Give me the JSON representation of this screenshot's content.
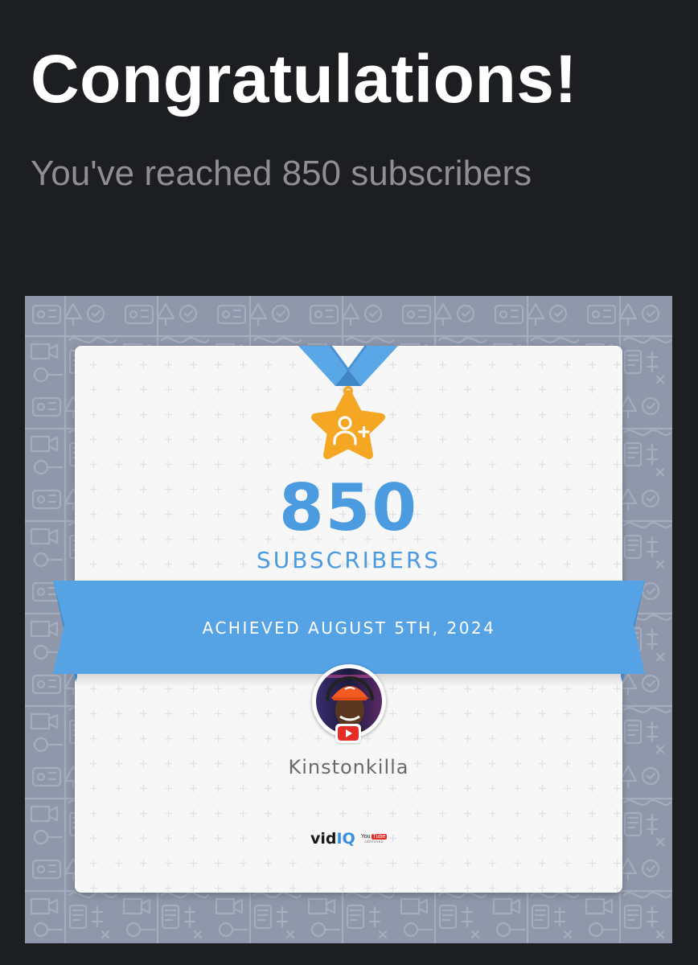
{
  "header": {
    "title": "Congratulations!",
    "subtitle": "You've reached 850 subscribers"
  },
  "card": {
    "count": "850",
    "count_label": "SUBSCRIBERS",
    "ribbon_text": "ACHIEVED AUGUST 5TH, 2024",
    "channel_name": "Kinstonkilla",
    "brand": {
      "part1": "vid",
      "part2": "IQ",
      "cert_you": "You",
      "cert_tube": "Tube",
      "cert_label": "CERTIFIED"
    }
  },
  "icons": {
    "medal": "star-medal-add-user-icon",
    "avatar": "channel-avatar",
    "platform": "youtube-play-icon"
  },
  "colors": {
    "page_background": "#1d1e22",
    "accent_blue": "#4a9be0",
    "ribbon_blue": "#55a3e5",
    "medal_gold": "#f5a623",
    "backdrop_gray": "#8f98ab",
    "youtube_red": "#e52d27"
  }
}
